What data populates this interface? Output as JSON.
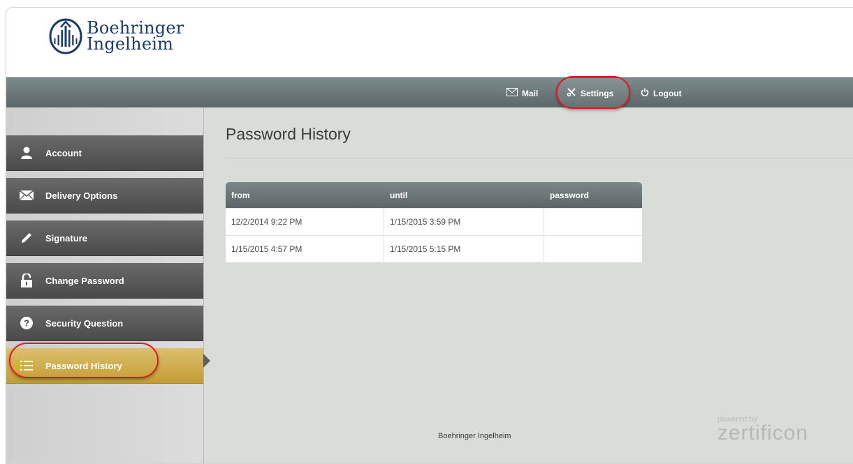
{
  "brand": {
    "name_line1": "Boehringer",
    "name_line2": "Ingelheim"
  },
  "topnav": {
    "mail": "Mail",
    "settings": "Settings",
    "logout": "Logout"
  },
  "sidebar": {
    "items": [
      {
        "label": "Account",
        "icon": "user-icon"
      },
      {
        "label": "Delivery Options",
        "icon": "envelope-icon"
      },
      {
        "label": "Signature",
        "icon": "pen-icon"
      },
      {
        "label": "Change Password",
        "icon": "lock-icon"
      },
      {
        "label": "Security Question",
        "icon": "question-icon"
      },
      {
        "label": "Password History",
        "icon": "list-icon",
        "active": true
      }
    ]
  },
  "main": {
    "title": "Password History",
    "table": {
      "headers": [
        "from",
        "until",
        "password"
      ],
      "rows": [
        [
          "12/2/2014 9:22 PM",
          "1/15/2015 3:59 PM",
          ""
        ],
        [
          "1/15/2015 4:57 PM",
          "1/15/2015 5:15 PM",
          ""
        ]
      ]
    }
  },
  "footer": {
    "company": "Boehringer Ingelheim",
    "powered_by": "powered by",
    "vendor": "zertificon"
  },
  "colors": {
    "accent_gold": "#c9a23c",
    "highlight_red": "#e0191f",
    "brand_blue": "#1a3a6a"
  }
}
